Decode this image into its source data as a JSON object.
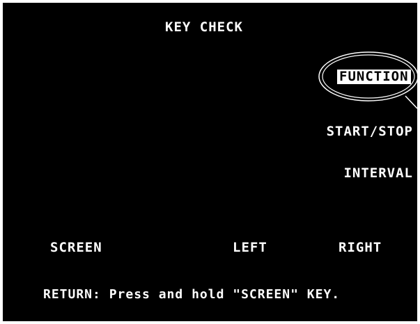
{
  "title": "KEY CHECK",
  "keys": {
    "function": "FUNCTION",
    "start_stop": "START/STOP",
    "interval": "INTERVAL",
    "screen": "SCREEN",
    "left": "LEFT",
    "right": "RIGHT"
  },
  "return_message": "RETURN: Press and hold \"SCREEN\" KEY.",
  "colors": {
    "background": "#000000",
    "text": "#ffffff",
    "highlight_bg": "#ffffff",
    "highlight_text": "#000000"
  }
}
